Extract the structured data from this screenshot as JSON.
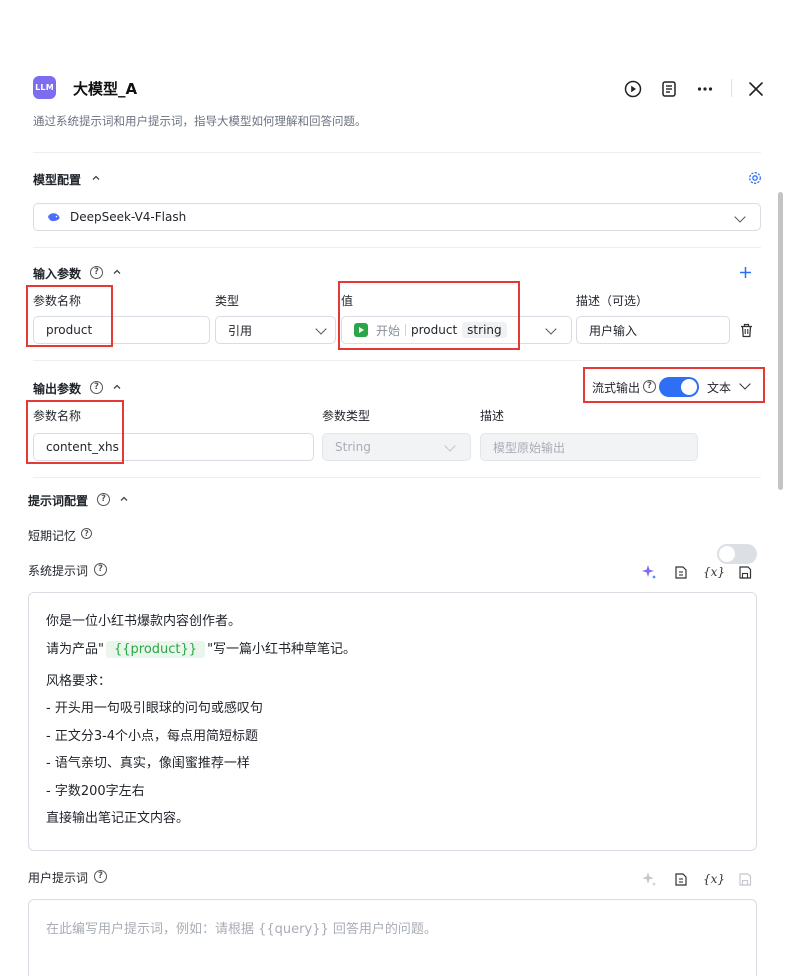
{
  "header": {
    "logo_text": "LLM",
    "title": "大模型_A",
    "description": "通过系统提示词和用户提示词，指导大模型如何理解和回答问题。",
    "icons": [
      "play-icon",
      "notes-icon",
      "more-icon",
      "close-icon"
    ]
  },
  "model_config": {
    "title": "模型配置",
    "model_name": "DeepSeek-V4-Flash"
  },
  "input_params": {
    "title": "输入参数",
    "col_name": "参数名称",
    "col_type": "类型",
    "col_value": "值",
    "col_desc": "描述（可选）",
    "rows": [
      {
        "name": "product",
        "type": "引用",
        "value_source": "开始",
        "value_var": "product",
        "value_type": "string",
        "desc": "用户输入"
      }
    ]
  },
  "output_params": {
    "title": "输出参数",
    "stream_label": "流式输出",
    "stream_on": true,
    "format": "文本",
    "col_name": "参数名称",
    "col_type": "参数类型",
    "col_desc": "描述",
    "rows": [
      {
        "name": "content_xhs",
        "type": "String",
        "desc_placeholder": "模型原始输出"
      }
    ]
  },
  "prompt_config": {
    "title": "提示词配置",
    "memory_label": "短期记忆",
    "memory_on": false,
    "system_label": "系统提示词",
    "system_lines": {
      "l1": "你是一位小红书爆款内容创作者。",
      "l2_pre": "请为产品\"",
      "l2_var": "{{product}}",
      "l2_post": "\"写一篇小红书种草笔记。",
      "l3": "风格要求：",
      "l4": "- 开头用一句吸引眼球的问句或感叹句",
      "l5": "- 正文分3-4个小点，每点用简短标题",
      "l6": "- 语气亲切、真实，像闺蜜推荐一样",
      "l7": "- 字数200字左右",
      "l8": "直接输出笔记正文内容。"
    },
    "user_label": "用户提示词",
    "user_placeholder": "在此编写用户提示词，例如：请根据 {{query}} 回答用户的问题。",
    "tools": [
      "sparkle-icon",
      "format-icon",
      "variable-icon",
      "save-icon"
    ],
    "var_tool_text": "{x}"
  },
  "colors": {
    "accent": "#2f6ff5",
    "logo": "#7b6cf0",
    "highlight_red": "#e53935",
    "variable_green": "#2aa647"
  }
}
